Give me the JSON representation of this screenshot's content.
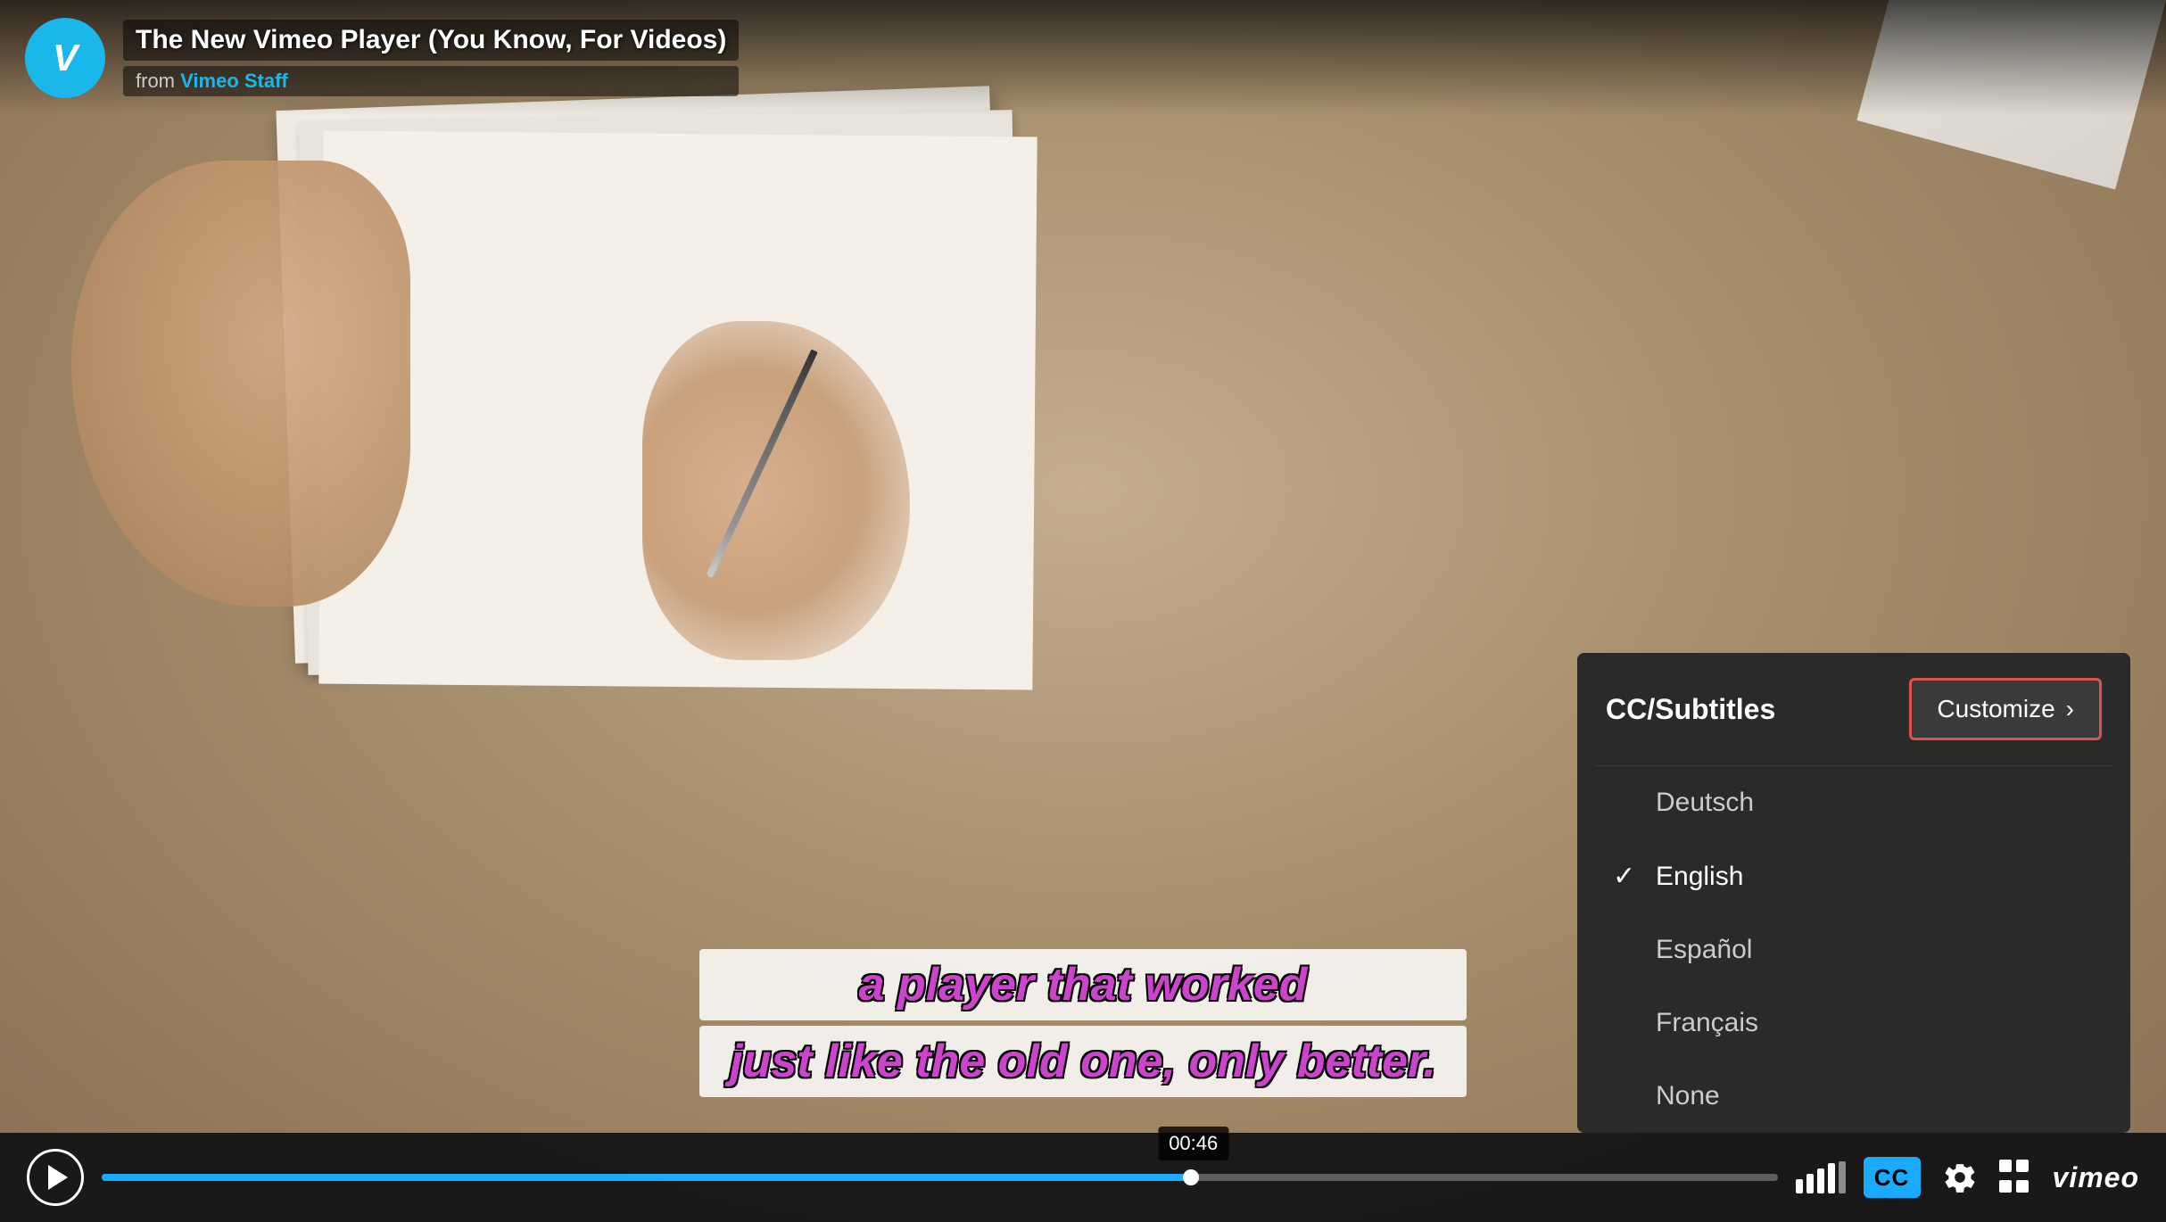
{
  "video": {
    "title": "The New Vimeo Player (You Know, For Videos)",
    "from_label": "from",
    "from_author": "Vimeo Staff",
    "current_time": "00:46",
    "progress_percent": 65
  },
  "subtitles": {
    "line1": "a player that worked",
    "line2": "just like the old one, only better."
  },
  "cc_menu": {
    "title": "CC/Subtitles",
    "customize_label": "Customize",
    "languages": [
      {
        "code": "de",
        "label": "Deutsch",
        "selected": false
      },
      {
        "code": "en",
        "label": "English",
        "selected": true
      },
      {
        "code": "es",
        "label": "Español",
        "selected": false
      },
      {
        "code": "fr",
        "label": "Français",
        "selected": false
      },
      {
        "code": "none",
        "label": "None",
        "selected": false
      }
    ]
  },
  "controls": {
    "cc_label": "CC",
    "vimeo_label": "vimeo",
    "volume_bars": [
      1,
      1,
      1,
      1,
      0
    ]
  },
  "colors": {
    "accent_blue": "#1ab7ea",
    "progress_blue": "#1aabff",
    "subtitle_color": "#cc44cc",
    "menu_bg": "#2a2a2a",
    "customize_border": "#e05050"
  }
}
